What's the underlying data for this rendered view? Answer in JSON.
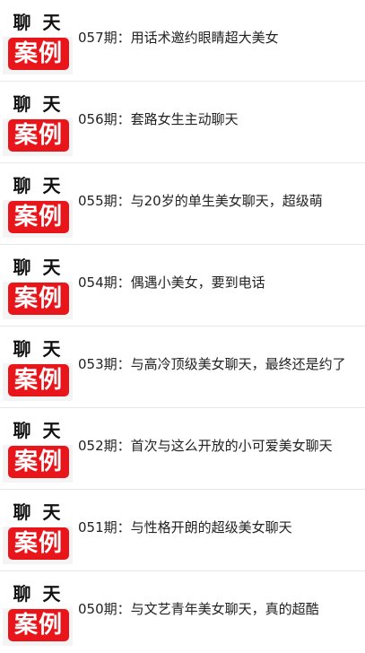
{
  "articles": [
    {
      "title": "057期：用话术邀约眼睛超大美女"
    },
    {
      "title": "056期：套路女生主动聊天"
    },
    {
      "title": "055期：与20岁的单生美女聊天，超级萌"
    },
    {
      "title": "054期：偶遇小美女，要到电话"
    },
    {
      "title": "053期：与高冷顶级美女聊天，最终还是约了"
    },
    {
      "title": "052期：首次与这么开放的小可爱美女聊天"
    },
    {
      "title": "051期：与性格开朗的超级美女聊天"
    },
    {
      "title": "050期：与文艺青年美女聊天，真的超酷"
    }
  ],
  "thumbnail": {
    "top_text": [
      "聊",
      "天"
    ],
    "badge_text": "案例",
    "badge_color": "#e8151b"
  }
}
